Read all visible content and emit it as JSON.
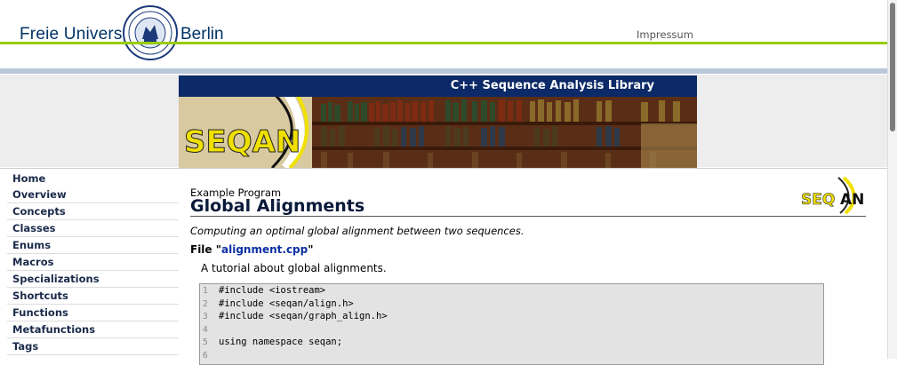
{
  "header": {
    "university_left": "Freie Universität",
    "university_right": "Berlin",
    "impressum": "Impressum"
  },
  "banner": {
    "title": "C++ Sequence Analysis Library",
    "logo_text": "SEQAN"
  },
  "sidebar": {
    "items": [
      {
        "label": "Home"
      },
      {
        "label": "Overview"
      },
      {
        "label": "Concepts"
      },
      {
        "label": "Classes"
      },
      {
        "label": "Enums"
      },
      {
        "label": "Macros"
      },
      {
        "label": "Specializations"
      },
      {
        "label": "Shortcuts"
      },
      {
        "label": "Functions"
      },
      {
        "label": "Metafunctions"
      },
      {
        "label": "Tags"
      }
    ]
  },
  "main": {
    "subtitle": "Example Program",
    "title": "Global Alignments",
    "description": "Computing an optimal global alignment between two sequences.",
    "file_prefix": "File \"",
    "file_name": "alignment.cpp",
    "file_suffix": "\"",
    "tutorial": "A tutorial about global alignments.",
    "code": [
      {
        "n": "1",
        "text": "#include <iostream>"
      },
      {
        "n": "2",
        "text": "#include <seqan/align.h>"
      },
      {
        "n": "3",
        "text": "#include <seqan/graph_align.h>"
      },
      {
        "n": "4",
        "text": ""
      },
      {
        "n": "5",
        "text": "using namespace seqan;"
      },
      {
        "n": "6",
        "text": ""
      }
    ]
  },
  "colors": {
    "fu_blue": "#003366",
    "green_rule": "#99cc00",
    "banner_bar": "#0c2a67",
    "link": "#0b2fa5"
  }
}
